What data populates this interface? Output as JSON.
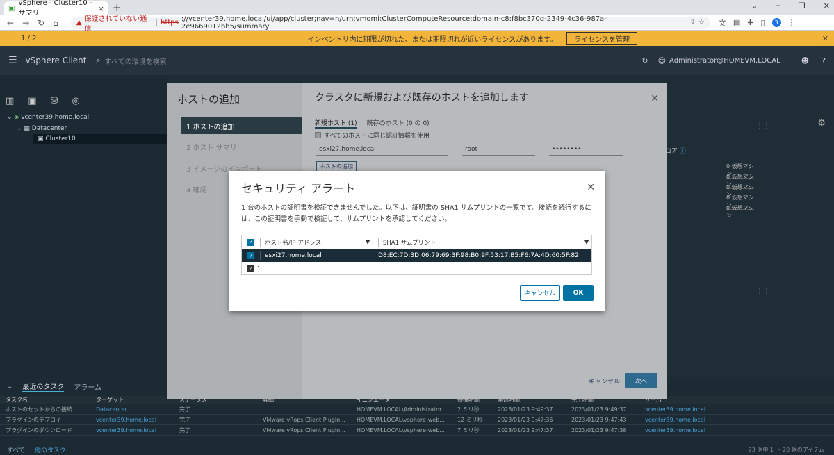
{
  "browser": {
    "tab_title": "vSphere - Cluster10 - サマリ",
    "tab_close": "×",
    "new_tab": "+",
    "warning_label": "保護されていない通信",
    "url_protocol": "https",
    "url_rest": "://vcenter39.home.local/ui/app/cluster;nav=h/urn:vmomi:ClusterComputeResource:domain-c8:f8bc370d-2349-4c36-987a-2e9669012bb5/summary",
    "profile_initial": "3"
  },
  "banner": {
    "pager": "1 / 2",
    "text": "インベントリ内に期限が切れた、または期限切れが近いライセンスがあります。",
    "button": "ライセンスを管理"
  },
  "header": {
    "app_title": "vSphere Client",
    "search_placeholder": "すべての環境を検索",
    "user": "Administrator@HOMEVM.LOCAL"
  },
  "tree": {
    "vcenter": "vcenter39.home.local",
    "datacenter": "Datacenter",
    "cluster": "Cluster10"
  },
  "background": {
    "vm_label": "0 仮想マシン",
    "core_label": "コア"
  },
  "wizard": {
    "title": "ホストの追加",
    "steps": [
      "1 ホストの追加",
      "2 ホスト サマリ",
      "3 イメージのインポート",
      "4 確認"
    ],
    "page_title": "クラスタに新規および既存のホストを追加します",
    "tab_new": "新規ホスト (1)",
    "tab_existing": "既存のホスト (0 の 0)",
    "same_cred": "すべてのホストに同じ認証情報を使用",
    "host_value": "esxi27.home.local",
    "user_value": "root",
    "pass_value": "••••••••",
    "add_host": "ホストの追加",
    "cancel": "キャンセル",
    "next": "次へ"
  },
  "dialog": {
    "title": "セキュリティ アラート",
    "message": "1 台のホストの証明書を検証できませんでした。以下は、証明書の SHA1 サムプリントの一覧です。接続を続行するには、この証明書を手動で検証して、サムプリントを承認してください。",
    "col_host": "ホスト名/IP アドレス",
    "col_sha": "SHA1 サムプリント",
    "row_host": "esxi27.home.local",
    "row_sha": "D8:EC:7D:3D:06:79:69:3F:98:B0:9F:53:17:B5:F6:7A:4D:60:5F:82",
    "footer_count": "1",
    "cancel": "キャンセル",
    "ok": "OK"
  },
  "tasks": {
    "tab_recent": "最近のタスク",
    "tab_alarms": "アラーム",
    "columns": [
      "タスク名",
      "ターゲット",
      "ステータス",
      "詳細",
      "イニシエータ",
      "待機時間",
      "開始時間",
      "完了時間",
      "サーバ"
    ],
    "rows": [
      [
        "ホストのセットからの接続...",
        "Datacenter",
        "完了",
        "",
        "HOMEVM.LOCAL\\Administrator",
        "2 ミリ秒",
        "2023/01/23 9:49:37",
        "2023/01/23 9:49:37",
        "vcenter39.home.local"
      ],
      [
        "プラグインのデプロイ",
        "vcenter39.home.local",
        "完了",
        "VMware vRops Client Plugin...",
        "HOMEVM.LOCAL\\vsphere-web...",
        "12 ミリ秒",
        "2023/01/23 9:47:36",
        "2023/01/23 9:47:43",
        "vcenter39.home.local"
      ],
      [
        "プラグインのダウンロード",
        "vcenter39.home.local",
        "完了",
        "VMware vRops Client Plugin...",
        "HOMEVM.LOCAL\\vsphere-web...",
        "7 ミリ秒",
        "2023/01/23 9:47:37",
        "2023/01/23 9:47:38",
        "vcenter39.home.local"
      ]
    ],
    "footer_all": "すべて",
    "footer_more": "他のタスク",
    "pager": "23 個中 1 〜 20 個のアイテム"
  }
}
